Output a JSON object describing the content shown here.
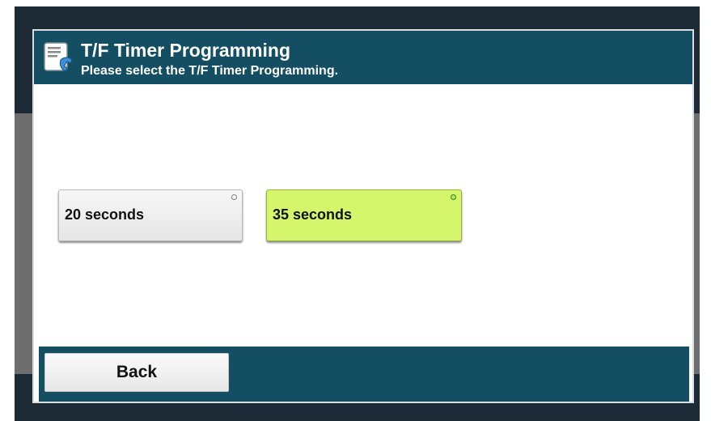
{
  "dialog": {
    "title": "T/F Timer Programming",
    "subtitle": "Please select the T/F Timer Programming.",
    "icon": "fax-phone-icon"
  },
  "options": [
    {
      "label": "20 seconds",
      "selected": false
    },
    {
      "label": "35 seconds",
      "selected": true
    }
  ],
  "footer": {
    "back_label": "Back"
  },
  "colors": {
    "header": "#134e62",
    "selected_option": "#d5f56b",
    "frame": "#1b2a34"
  }
}
